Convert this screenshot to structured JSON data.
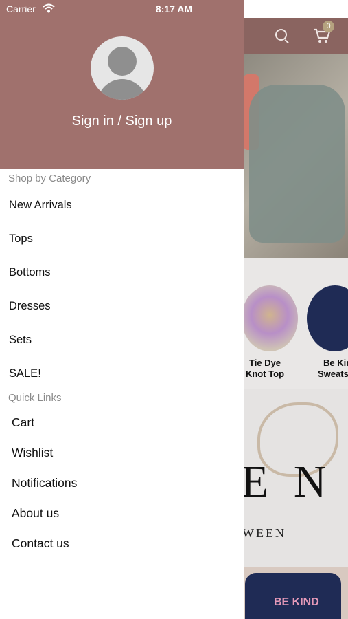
{
  "status_bar": {
    "carrier": "Carrier",
    "time": "8:17 AM"
  },
  "drawer": {
    "auth_label": "Sign in / Sign up",
    "shop_section_title": "Shop by Category",
    "categories": [
      "New Arrivals",
      "Tops",
      "Bottoms",
      "Dresses",
      "Sets",
      "SALE!"
    ],
    "quick_section_title": "Quick Links",
    "quick_links": [
      "Cart",
      "Wishlist",
      "Notifications",
      "About us",
      "Contact us"
    ]
  },
  "background": {
    "cart_count": "0",
    "products": [
      {
        "name_line1": "Tie Dye",
        "name_line2": "Knot Top"
      },
      {
        "name_line1": "Be Kin",
        "name_line2": "Sweats"
      }
    ],
    "brand_letters": "E N",
    "brand_sub": "WEEN",
    "sweat_text": "BE KIND"
  },
  "colors": {
    "accent": "#a0716d",
    "topbar": "#8a6460",
    "badge": "#b5a27f"
  },
  "icons": [
    "wifi-icon",
    "battery-icon",
    "user-avatar-icon",
    "search-icon",
    "cart-icon"
  ]
}
